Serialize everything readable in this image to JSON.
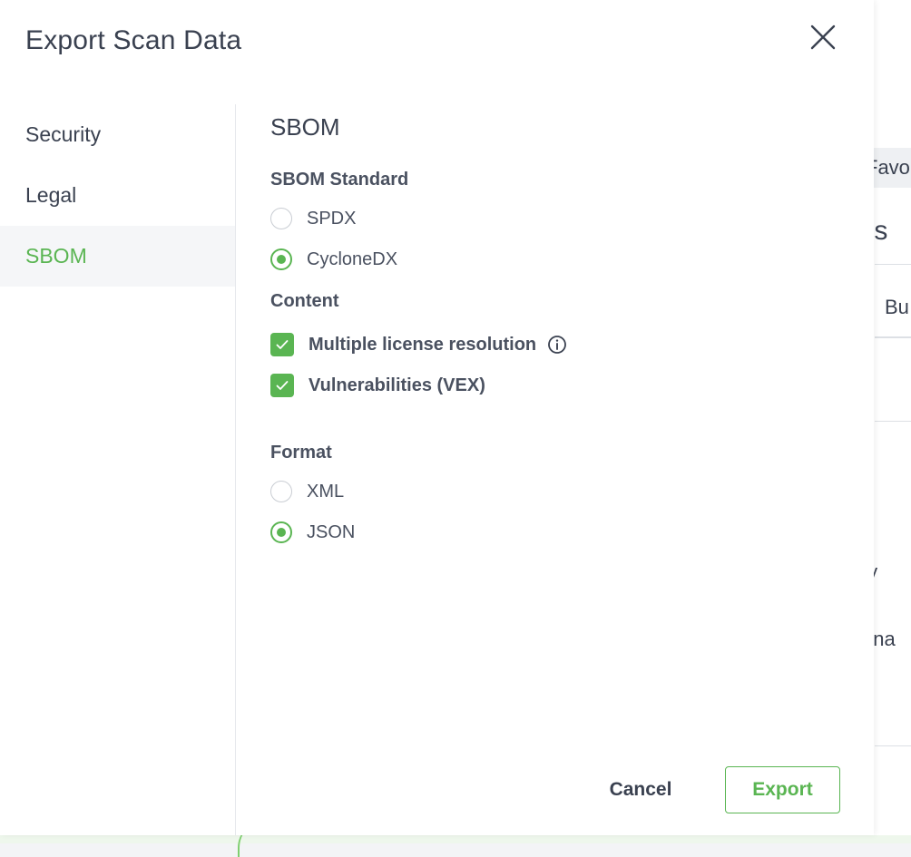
{
  "background": {
    "favorites_fragment": "Favorit",
    "heading_fragment": "ies",
    "column_fragment": "Bu",
    "row1_fragment": "ty",
    "row2_fragment": "ona"
  },
  "modal": {
    "title": "Export Scan Data",
    "close_icon": "close-icon"
  },
  "sidebar": {
    "items": [
      {
        "label": "Security",
        "active": false
      },
      {
        "label": "Legal",
        "active": false
      },
      {
        "label": "SBOM",
        "active": true
      }
    ]
  },
  "sbom": {
    "section_title": "SBOM",
    "standard": {
      "label": "SBOM Standard",
      "options": [
        {
          "label": "SPDX",
          "selected": false
        },
        {
          "label": "CycloneDX",
          "selected": true
        }
      ]
    },
    "content": {
      "label": "Content",
      "options": [
        {
          "label": "Multiple license resolution",
          "checked": true,
          "icon": "info-icon"
        },
        {
          "label": "Vulnerabilities (VEX)",
          "checked": true
        }
      ]
    },
    "format": {
      "label": "Format",
      "options": [
        {
          "label": "XML",
          "selected": false
        },
        {
          "label": "JSON",
          "selected": true
        }
      ]
    }
  },
  "footer": {
    "cancel_label": "Cancel",
    "export_label": "Export"
  },
  "colors": {
    "accent": "#5ab552",
    "text": "#3a4150",
    "sidebar_active_bg": "#f5f6f8"
  }
}
